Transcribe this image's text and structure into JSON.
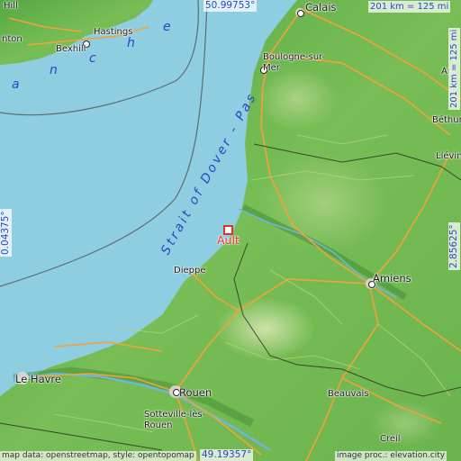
{
  "map": {
    "colors": {
      "sea": "#8fcde0",
      "land_low": "#5fb04a",
      "land_mid": "#8cc95e",
      "land_high": "#c7dda0",
      "roads": "#f2a23a",
      "borders": "#222222",
      "marker": "#e03030",
      "label_blue": "#2d46c8"
    },
    "place_marker": {
      "name": "Ault",
      "icon": "square-marker-icon"
    },
    "cities": [
      {
        "id": "calais",
        "name": "Calais"
      },
      {
        "id": "hill",
        "name": "Hill"
      },
      {
        "id": "nton",
        "name": "nton"
      },
      {
        "id": "hastings",
        "name": "Hastings"
      },
      {
        "id": "bexhill",
        "name": "Bexhill"
      },
      {
        "id": "boulogne",
        "name": "Boulogne-sur-\nMer"
      },
      {
        "id": "bethune",
        "name": "Béthun"
      },
      {
        "id": "lievin",
        "name": "Liévin"
      },
      {
        "id": "ar",
        "name": "Ar"
      },
      {
        "id": "dieppe",
        "name": "Dieppe"
      },
      {
        "id": "amiens",
        "name": "Amiens"
      },
      {
        "id": "lehavre",
        "name": "Le Havre"
      },
      {
        "id": "rouen",
        "name": "Rouen"
      },
      {
        "id": "sotteville",
        "name": "Sotteville-lès-\nRouen"
      },
      {
        "id": "beauvais",
        "name": "Beauvais"
      },
      {
        "id": "creil",
        "name": "Creil"
      }
    ],
    "sea_labels": {
      "strait": "Strait of Dover - Pas",
      "channel_letters": [
        "a",
        "n",
        "c",
        "h",
        "e"
      ]
    },
    "coords": {
      "top": "50.99753°",
      "bottom": "49.19357°",
      "left": "0.04375°",
      "right": "2.85625°"
    },
    "scale": {
      "horizontal": "201 km = 125 mi",
      "vertical": "201 km = 125 mi"
    },
    "credits": {
      "left": "map data: openstreetmap, style: opentopomap",
      "right": "image proc.: elevation.city"
    }
  }
}
